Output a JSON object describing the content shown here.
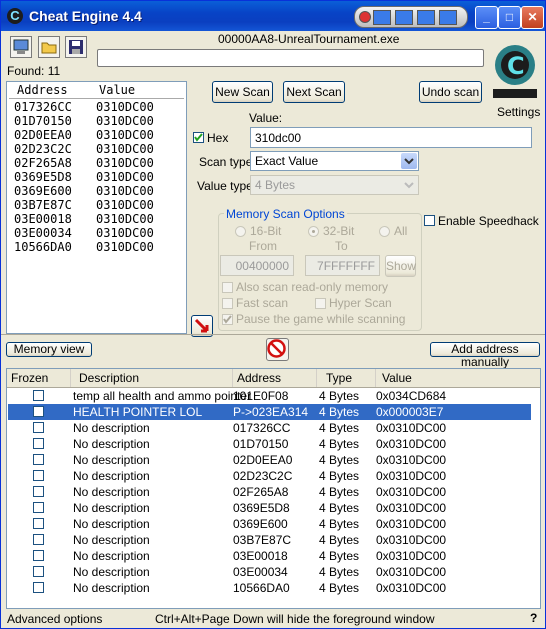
{
  "window": {
    "title": "Cheat Engine 4.4"
  },
  "process_title": "00000AA8-UnrealTournament.exe",
  "found_count": "Found: 11",
  "toolbar": {
    "open_process": "open-process-icon",
    "open_file": "open-folder-icon",
    "save": "save-icon"
  },
  "scan_results": {
    "col_address": "Address",
    "col_value": "Value",
    "rows": [
      {
        "address": "017326CC",
        "value": "0310DC00"
      },
      {
        "address": "01D70150",
        "value": "0310DC00"
      },
      {
        "address": "02D0EEA0",
        "value": "0310DC00"
      },
      {
        "address": "02D23C2C",
        "value": "0310DC00"
      },
      {
        "address": "02F265A8",
        "value": "0310DC00"
      },
      {
        "address": "0369E5D8",
        "value": "0310DC00"
      },
      {
        "address": "0369E600",
        "value": "0310DC00"
      },
      {
        "address": "03B7E87C",
        "value": "0310DC00"
      },
      {
        "address": "03E00018",
        "value": "0310DC00"
      },
      {
        "address": "03E00034",
        "value": "0310DC00"
      },
      {
        "address": "10566DA0",
        "value": "0310DC00"
      }
    ]
  },
  "buttons": {
    "new_scan": "New Scan",
    "next_scan": "Next Scan",
    "undo_scan": "Undo scan",
    "settings": "Settings",
    "memory_view": "Memory view",
    "add_address": "Add address manually",
    "show": "Show"
  },
  "scan": {
    "value_label": "Value:",
    "hex_label": "Hex",
    "value": "310dc00",
    "scan_type_label": "Scan type",
    "scan_type": "Exact Value",
    "value_type_label": "Value type",
    "value_type": "4 Bytes"
  },
  "memory_options": {
    "title": "Memory Scan Options",
    "bit16": "16-Bit",
    "bit32": "32-Bit",
    "all": "All",
    "from_label": "From",
    "to_label": "To",
    "from": "00400000",
    "to": "7FFFFFFF",
    "readonly": "Also scan read-only memory",
    "fast": "Fast scan",
    "hyper": "Hyper Scan",
    "pause": "Pause the game while scanning"
  },
  "speedhack_label": "Enable Speedhack",
  "address_list": {
    "col_frozen": "Frozen",
    "col_description": "Description",
    "col_address": "Address",
    "col_type": "Type",
    "col_value": "Value",
    "rows": [
      {
        "description": "temp all health and ammo pointer",
        "address": "101E0F08",
        "type": "4 Bytes",
        "value": "0x034CD684"
      },
      {
        "description": "HEALTH POINTER LOL",
        "address": "P->023EA314",
        "type": "4 Bytes",
        "value": "0x000003E7"
      },
      {
        "description": "No description",
        "address": "017326CC",
        "type": "4 Bytes",
        "value": "0x0310DC00"
      },
      {
        "description": "No description",
        "address": "01D70150",
        "type": "4 Bytes",
        "value": "0x0310DC00"
      },
      {
        "description": "No description",
        "address": "02D0EEA0",
        "type": "4 Bytes",
        "value": "0x0310DC00"
      },
      {
        "description": "No description",
        "address": "02D23C2C",
        "type": "4 Bytes",
        "value": "0x0310DC00"
      },
      {
        "description": "No description",
        "address": "02F265A8",
        "type": "4 Bytes",
        "value": "0x0310DC00"
      },
      {
        "description": "No description",
        "address": "0369E5D8",
        "type": "4 Bytes",
        "value": "0x0310DC00"
      },
      {
        "description": "No description",
        "address": "0369E600",
        "type": "4 Bytes",
        "value": "0x0310DC00"
      },
      {
        "description": "No description",
        "address": "03B7E87C",
        "type": "4 Bytes",
        "value": "0x0310DC00"
      },
      {
        "description": "No description",
        "address": "03E00018",
        "type": "4 Bytes",
        "value": "0x0310DC00"
      },
      {
        "description": "No description",
        "address": "03E00034",
        "type": "4 Bytes",
        "value": "0x0310DC00"
      },
      {
        "description": "No description",
        "address": "10566DA0",
        "type": "4 Bytes",
        "value": "0x0310DC00"
      }
    ]
  },
  "status": {
    "advanced": "Advanced options",
    "hint": "Ctrl+Alt+Page Down will hide the foreground window",
    "help": "?"
  },
  "colors": {
    "title_bar": "#0a4fd0",
    "selection": "#316ac5",
    "logo": "#2a7f86"
  }
}
